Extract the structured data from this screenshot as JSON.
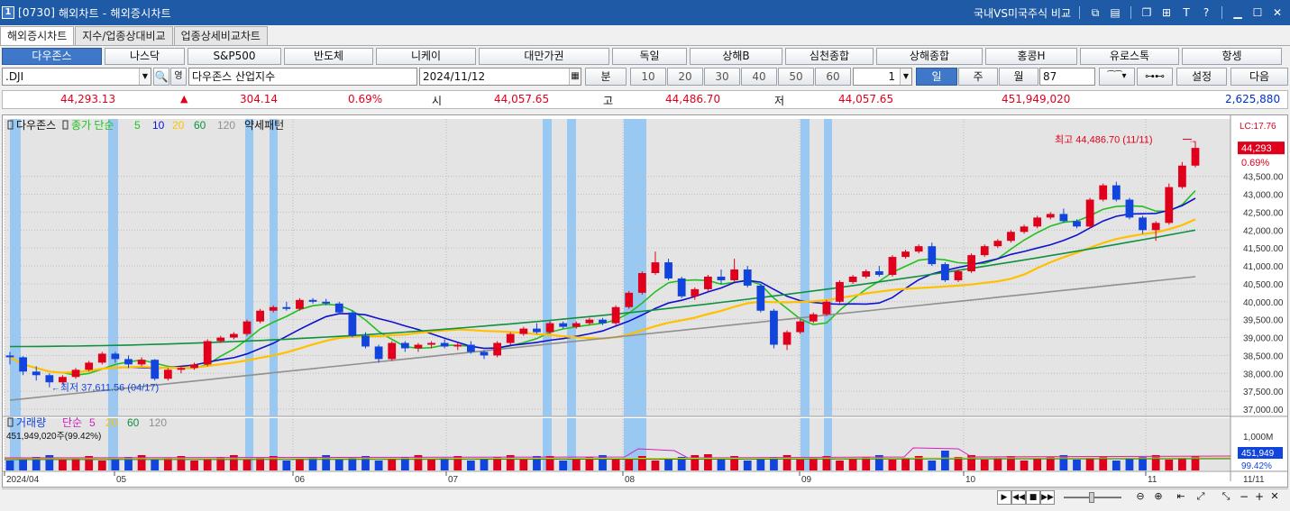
{
  "titlebar": {
    "window_id": "[0730]",
    "title": "해외차트 - 해외증시차트",
    "compare_label": "국내VS미국주식 비교"
  },
  "tabs": [
    "해외증시차트",
    "지수/업종상대비교",
    "업종상세비교차트"
  ],
  "index_buttons": [
    "다우존스",
    "나스닥",
    "S&P500",
    "반도체",
    "니케이",
    "대만가권",
    "독일",
    "상해B",
    "심천종합",
    "상해종합",
    "홍콩H",
    "유로스톡",
    "항셍"
  ],
  "controls": {
    "symbol": ".DJI",
    "symbol_name": "다우존스 산업지수",
    "date": "2024/11/12",
    "minute_label": "분",
    "minute_options": [
      "10",
      "20",
      "30",
      "40",
      "50",
      "60"
    ],
    "count": "1",
    "period_day": "일",
    "period_week": "주",
    "period_month": "월",
    "bars": "87",
    "settings": "설정",
    "next": "다음"
  },
  "quote": {
    "price": "44,293.13",
    "change_arrow": "▲",
    "change": "304.14",
    "change_pct": "0.69%",
    "open_label": "시",
    "open": "44,057.65",
    "high_label": "고",
    "high": "44,486.70",
    "low_label": "저",
    "low": "44,057.65",
    "volume": "451,949,020",
    "amount": "2,625,880"
  },
  "chart_header": {
    "name": "다우존스",
    "ma_label": "종가 단순",
    "ma_periods": [
      "5",
      "10",
      "20",
      "60",
      "120"
    ],
    "pattern_label": "약세패턴",
    "ma_colors": [
      "#22c01e",
      "#1010d0",
      "#ffc000",
      "#109040",
      "#909090"
    ]
  },
  "volume_header": {
    "name": "거래량",
    "ma_label": "단순",
    "ma_periods": [
      "5",
      "20",
      "60",
      "120"
    ],
    "summary": "451,949,020주(99.42%)"
  },
  "annotations": {
    "max_label": "최고 44,486.70 (11/11)",
    "min_label": "최저 37,611.56 (04/17)",
    "lc_label": "LC:17.76",
    "last_price": "44,293",
    "last_pct": "0.69%",
    "vol_last": "451,949",
    "vol_pct": "99.42%",
    "vol_axis_max": "1,000M",
    "right_date": "11/11"
  },
  "chart_data": {
    "type": "candlestick",
    "x_axis_labels": [
      "2024/04",
      "05",
      "06",
      "07",
      "08",
      "09",
      "10",
      "11"
    ],
    "y_ticks": [
      "43,500.00",
      "43,000.00",
      "42,500.00",
      "42,000.00",
      "41,500.00",
      "41,000.00",
      "40,500.00",
      "40,000.00",
      "39,500.00",
      "39,000.00",
      "38,500.00",
      "38,000.00",
      "37,500.00",
      "37,000.00"
    ],
    "ylim": [
      36800,
      44800
    ],
    "candles": [
      [
        38500,
        38600,
        38250,
        38450
      ],
      [
        38450,
        38480,
        37950,
        38050
      ],
      [
        38050,
        38200,
        37800,
        37950
      ],
      [
        37950,
        38000,
        37611.56,
        37750
      ],
      [
        37750,
        37950,
        37700,
        37900
      ],
      [
        37900,
        38150,
        37850,
        38100
      ],
      [
        38100,
        38350,
        38050,
        38300
      ],
      [
        38300,
        38600,
        38250,
        38550
      ],
      [
        38550,
        38600,
        38300,
        38400
      ],
      [
        38400,
        38500,
        38150,
        38250
      ],
      [
        38250,
        38450,
        38200,
        38380
      ],
      [
        38380,
        38400,
        37800,
        37850
      ],
      [
        37850,
        38150,
        37800,
        38100
      ],
      [
        38100,
        38200,
        38000,
        38150
      ],
      [
        38150,
        38300,
        38100,
        38250
      ],
      [
        38250,
        38950,
        38200,
        38900
      ],
      [
        38900,
        39050,
        38850,
        39000
      ],
      [
        39000,
        39150,
        38950,
        39100
      ],
      [
        39100,
        39500,
        39050,
        39450
      ],
      [
        39450,
        39800,
        39400,
        39750
      ],
      [
        39750,
        39900,
        39700,
        39850
      ],
      [
        39850,
        40000,
        39750,
        39800
      ],
      [
        39800,
        40100,
        39750,
        40050
      ],
      [
        40050,
        40100,
        39950,
        40000
      ],
      [
        40000,
        40080,
        39900,
        39950
      ],
      [
        39950,
        40000,
        39650,
        39700
      ],
      [
        39700,
        39750,
        39000,
        39050
      ],
      [
        39050,
        39150,
        38700,
        38750
      ],
      [
        38750,
        38800,
        38300,
        38400
      ],
      [
        38400,
        38900,
        38350,
        38850
      ],
      [
        38850,
        38900,
        38600,
        38700
      ],
      [
        38700,
        38850,
        38600,
        38800
      ],
      [
        38800,
        38900,
        38700,
        38850
      ],
      [
        38850,
        38950,
        38700,
        38750
      ],
      [
        38750,
        38850,
        38650,
        38800
      ],
      [
        38800,
        38900,
        38550,
        38600
      ],
      [
        38600,
        38650,
        38400,
        38500
      ],
      [
        38500,
        38900,
        38450,
        38850
      ],
      [
        38850,
        39150,
        38800,
        39100
      ],
      [
        39100,
        39300,
        39050,
        39250
      ],
      [
        39250,
        39400,
        39100,
        39150
      ],
      [
        39150,
        39450,
        39100,
        39400
      ],
      [
        39400,
        39450,
        39250,
        39300
      ],
      [
        39300,
        39450,
        39250,
        39400
      ],
      [
        39400,
        39550,
        39350,
        39500
      ],
      [
        39500,
        39550,
        39350,
        39400
      ],
      [
        39400,
        39900,
        39350,
        39850
      ],
      [
        39850,
        40300,
        39800,
        40250
      ],
      [
        40250,
        40850,
        40200,
        40800
      ],
      [
        40800,
        41400,
        40750,
        41100
      ],
      [
        41100,
        41200,
        40600,
        40650
      ],
      [
        40650,
        40700,
        40100,
        40150
      ],
      [
        40150,
        40400,
        40050,
        40350
      ],
      [
        40350,
        40750,
        40300,
        40700
      ],
      [
        40700,
        40900,
        40500,
        40600
      ],
      [
        40600,
        41200,
        40550,
        40900
      ],
      [
        40900,
        41000,
        40400,
        40450
      ],
      [
        40450,
        40500,
        39700,
        39750
      ],
      [
        39750,
        39800,
        38700,
        38800
      ],
      [
        38800,
        39200,
        38650,
        39150
      ],
      [
        39150,
        39500,
        39100,
        39450
      ],
      [
        39450,
        39700,
        39400,
        39650
      ],
      [
        39650,
        40050,
        39600,
        40000
      ],
      [
        40000,
        40600,
        39950,
        40550
      ],
      [
        40550,
        40750,
        40500,
        40700
      ],
      [
        40700,
        40900,
        40650,
        40850
      ],
      [
        40850,
        41000,
        40700,
        40750
      ],
      [
        40750,
        41300,
        40700,
        41250
      ],
      [
        41250,
        41450,
        41200,
        41400
      ],
      [
        41400,
        41600,
        41350,
        41550
      ],
      [
        41550,
        41650,
        41000,
        41050
      ],
      [
        41050,
        41100,
        40550,
        40600
      ],
      [
        40600,
        40900,
        40550,
        40850
      ],
      [
        40850,
        41350,
        40800,
        41300
      ],
      [
        41300,
        41600,
        41250,
        41550
      ],
      [
        41550,
        41750,
        41500,
        41700
      ],
      [
        41700,
        42000,
        41650,
        41950
      ],
      [
        41950,
        42150,
        41900,
        42100
      ],
      [
        42100,
        42400,
        42050,
        42350
      ],
      [
        42350,
        42500,
        42300,
        42450
      ],
      [
        42450,
        42600,
        42200,
        42250
      ],
      [
        42250,
        42300,
        42050,
        42100
      ],
      [
        42100,
        42900,
        42050,
        42850
      ],
      [
        42850,
        43300,
        42800,
        43250
      ],
      [
        43250,
        43350,
        42800,
        42850
      ],
      [
        42850,
        42900,
        42300,
        42350
      ],
      [
        42350,
        42400,
        41900,
        42000
      ],
      [
        42000,
        42250,
        41700,
        42200
      ],
      [
        42200,
        43300,
        42150,
        43200
      ],
      [
        43200,
        43900,
        43150,
        43800
      ],
      [
        43800,
        44486.7,
        43750,
        44293
      ]
    ]
  }
}
